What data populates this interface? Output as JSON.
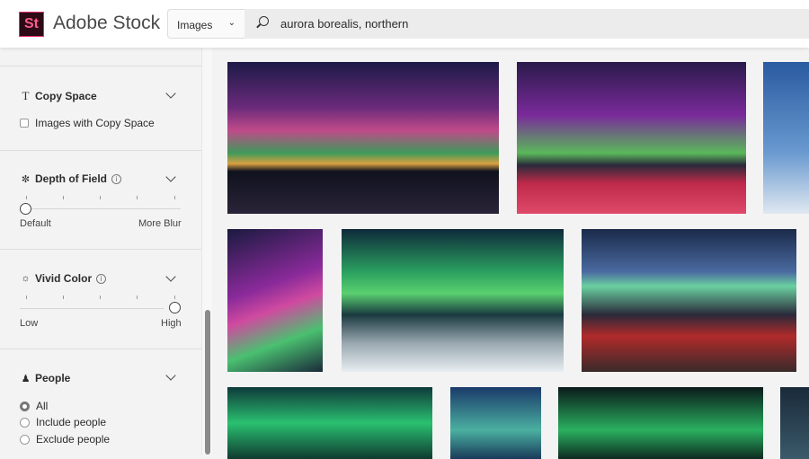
{
  "header": {
    "logo": "St",
    "brand": "Adobe Stock",
    "type_select": "Images",
    "search_value": "aurora borealis, northern"
  },
  "filters": {
    "copy_space": {
      "title": "Copy Space",
      "option": "Images with Copy Space",
      "checked": false
    },
    "depth_of_field": {
      "title": "Depth of Field",
      "min_label": "Default",
      "max_label": "More Blur",
      "value": 0
    },
    "vivid_color": {
      "title": "Vivid Color",
      "min_label": "Low",
      "max_label": "High",
      "value": 1
    },
    "people": {
      "title": "People",
      "options": [
        "All",
        "Include people",
        "Exclude people"
      ],
      "selected": "All"
    }
  },
  "results": [
    "aurora over lake town",
    "tents under aurora",
    "snowy trees",
    "aurora streaks",
    "green aurora over mountain",
    "red cabins under aurora",
    "green aurora",
    "aurora over trees",
    "green aurora sky",
    "aurora"
  ]
}
